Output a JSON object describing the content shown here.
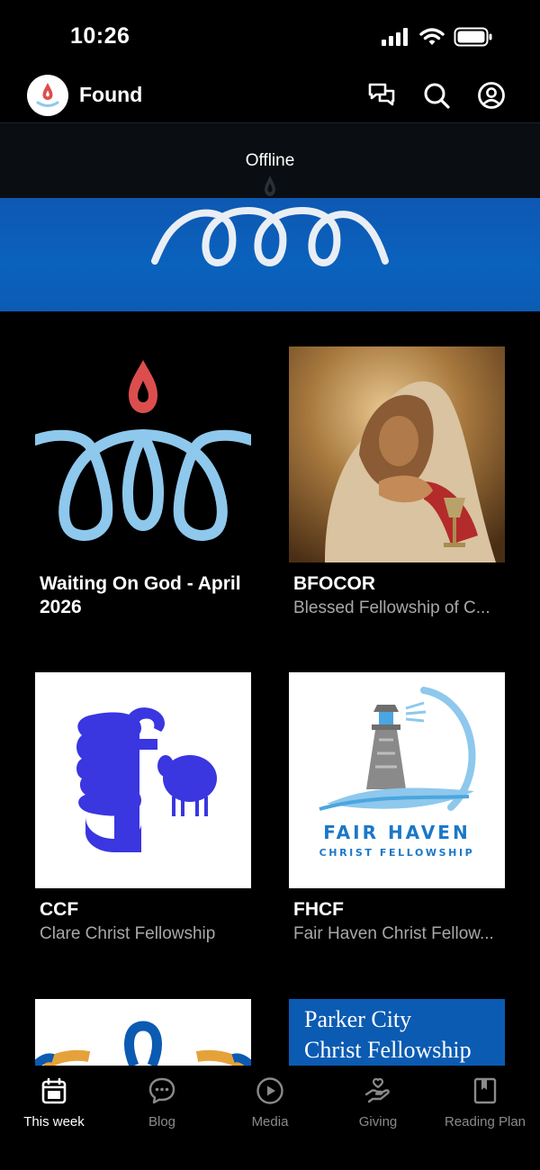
{
  "status": {
    "time": "10:26"
  },
  "header": {
    "app_name": "Found",
    "icons": [
      "chat-bubbles-icon",
      "search-icon",
      "account-icon"
    ]
  },
  "offline": {
    "text": "Offline"
  },
  "cards": [
    {
      "title": "Waiting On God - April 2026",
      "subtitle": ""
    },
    {
      "title": "BFOCOR",
      "subtitle": "Blessed Fellowship of C..."
    },
    {
      "title": "CCF",
      "subtitle": "Clare Christ Fellowship"
    },
    {
      "title": "FHCF",
      "subtitle": "Fair Haven Christ Fellow..."
    }
  ],
  "thumb_text": {
    "fair_haven_line1": "FAIR HAVEN",
    "fair_haven_line2": "CHRIST FELLOWSHIP",
    "parker_line1": "Parker City",
    "parker_line2": "Christ Fellowship"
  },
  "tabs": [
    {
      "label": "This week",
      "icon": "calendar-icon",
      "active": true
    },
    {
      "label": "Blog",
      "icon": "chat-dots-icon",
      "active": false
    },
    {
      "label": "Media",
      "icon": "play-circle-icon",
      "active": false
    },
    {
      "label": "Giving",
      "icon": "giving-hand-icon",
      "active": false
    },
    {
      "label": "Reading Plan",
      "icon": "bookmark-book-icon",
      "active": false
    }
  ],
  "colors": {
    "accent_blue": "#0b5bb2",
    "flame_red": "#dc4e4e",
    "loop_light_blue": "#8ec8ec",
    "ccf_blue": "#3a36e0"
  }
}
